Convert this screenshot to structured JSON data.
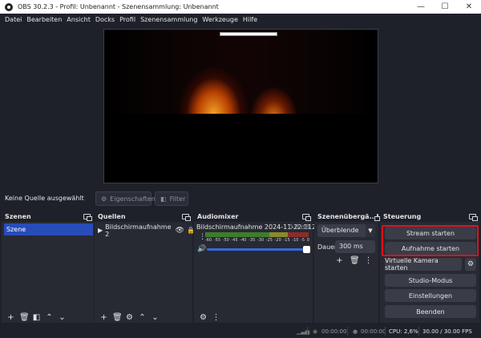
{
  "window": {
    "title": "OBS 30.2.3 - Profil: Unbenannt - Szenensammlung: Unbenannt",
    "minimize": "—",
    "maximize": "☐",
    "close": "✕"
  },
  "menu": [
    "Datei",
    "Bearbeiten",
    "Ansicht",
    "Docks",
    "Profil",
    "Szenensammlung",
    "Werkzeuge",
    "Hilfe"
  ],
  "context": {
    "no_source": "Keine Quelle ausgewählt",
    "properties": "Eigenschaften",
    "filters": "Filter"
  },
  "docks": {
    "scenes": {
      "title": "Szenen",
      "items": [
        "Szene"
      ]
    },
    "sources": {
      "title": "Quellen",
      "items": [
        "Bildschirmaufnahme 2"
      ]
    },
    "mixer": {
      "title": "Audiomixer",
      "channel": "Bildschirmaufnahme 2024-11-22 112",
      "db": "0.0 dB",
      "scale": [
        "-60",
        "-55",
        "-50",
        "-45",
        "-40",
        "-35",
        "-30",
        "-25",
        "-20",
        "-15",
        "-10",
        "-5",
        "0"
      ],
      "volume": 1.0
    },
    "transitions": {
      "title": "Szenenübergä...",
      "selected": "Überblende",
      "duration_label": "Dauer",
      "duration_value": "300 ms"
    },
    "controls": {
      "title": "Steuerung",
      "start_stream": "Stream starten",
      "start_recording": "Aufnahme starten",
      "virtual_camera": "Virtuelle Kamera starten",
      "studio_mode": "Studio-Modus",
      "settings": "Einstellungen",
      "exit": "Beenden"
    }
  },
  "status": {
    "stream_time": "00:00:00",
    "rec_time": "00:00:00",
    "cpu": "CPU: 2,6%",
    "fps": "30.00 / 30.00 FPS"
  },
  "colors": {
    "accent": "#284cb8",
    "highlight": "#e01020",
    "background": "#1f212a",
    "panel": "#272a33"
  }
}
